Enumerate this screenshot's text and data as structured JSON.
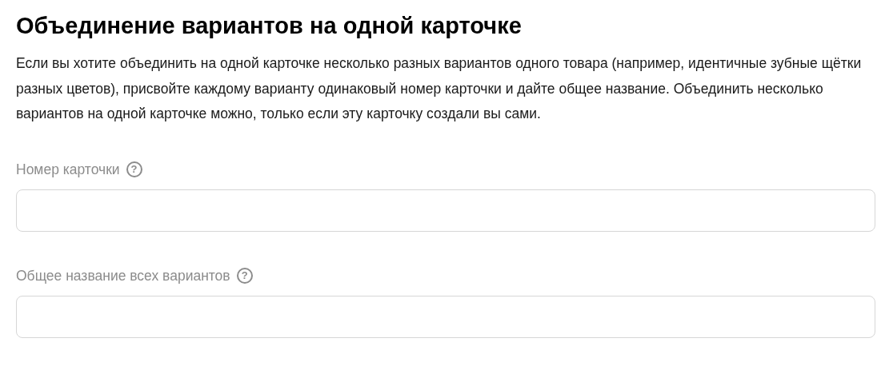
{
  "title": "Объединение вариантов на одной карточке",
  "description": "Если вы хотите объединить на одной карточке несколько разных вариантов одного товара (например, идентичные зубные щётки разных цветов), присвойте каждому варианту одинаковый номер карточки и дайте общее название. Объединить несколько вариантов на одной карточке можно, только если эту карточку создали вы сами.",
  "fields": [
    {
      "label": "Номер карточки",
      "help_icon": "?"
    },
    {
      "label": "Общее название всех вариантов",
      "help_icon": "?"
    }
  ]
}
